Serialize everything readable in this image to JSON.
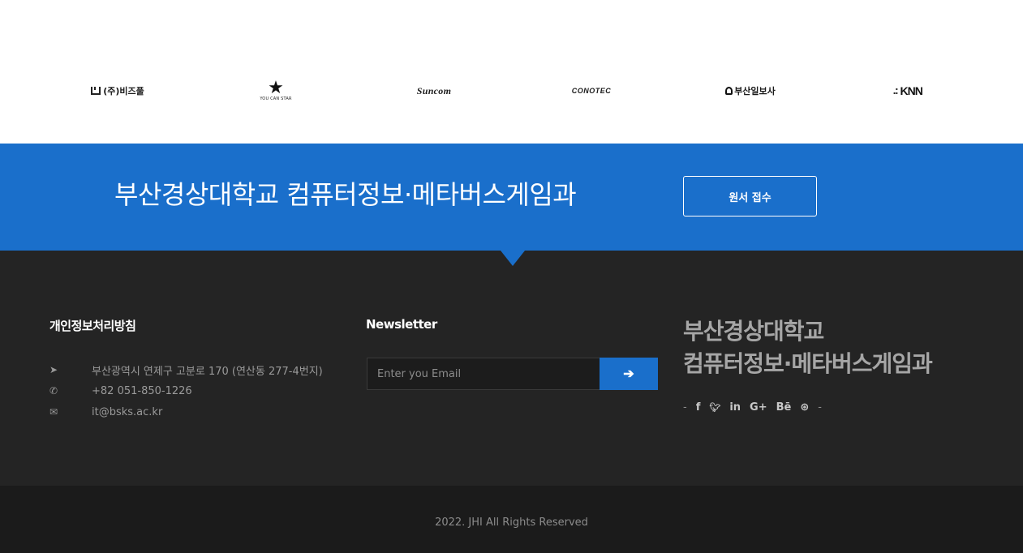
{
  "partners": {
    "items": [
      {
        "name": "(주)비즈풀",
        "icon": "bizpool-logo"
      },
      {
        "name": "YOU CAN STAR",
        "icon": "youcanstar-logo"
      },
      {
        "name": "Suncom",
        "icon": "suncom-logo"
      },
      {
        "name": "CONOTEC",
        "icon": "conotec-logo"
      },
      {
        "name": "부산일보사",
        "icon": "busanilbo-logo"
      },
      {
        "name": "KNN",
        "icon": "knn-logo"
      }
    ]
  },
  "banner": {
    "title": "부산경상대학교 컴퓨터정보·메타버스게임과",
    "apply_label": "원서 접수",
    "color": "#1a6fcb"
  },
  "footer": {
    "privacy_title": "개인정보처리방침",
    "contact": [
      {
        "icon": "location-arrow-icon",
        "glyph": "➤",
        "text": "부산광역시 연제구 고분로 170 (연산동 277-4번지)"
      },
      {
        "icon": "phone-icon",
        "glyph": "✆",
        "text": "+82 051-850-1226"
      },
      {
        "icon": "envelope-icon",
        "glyph": "✉",
        "text": "it@bsks.ac.kr"
      }
    ],
    "newsletter_title": "Newsletter",
    "email_placeholder": "Enter you Email",
    "submit_glyph": "➔",
    "brand_line1": "부산경상대학교",
    "brand_line2": "컴퓨터정보·메타버스게임과",
    "social": [
      {
        "icon": "facebook-icon",
        "glyph": "f"
      },
      {
        "icon": "twitter-icon",
        "glyph": "🐦"
      },
      {
        "icon": "linkedin-icon",
        "glyph": "in"
      },
      {
        "icon": "google-plus-icon",
        "glyph": "G+"
      },
      {
        "icon": "behance-icon",
        "glyph": "Bē"
      },
      {
        "icon": "dribbble-icon",
        "glyph": "⊛"
      }
    ],
    "copyright": "2022. JHI All Rights Reserved"
  }
}
